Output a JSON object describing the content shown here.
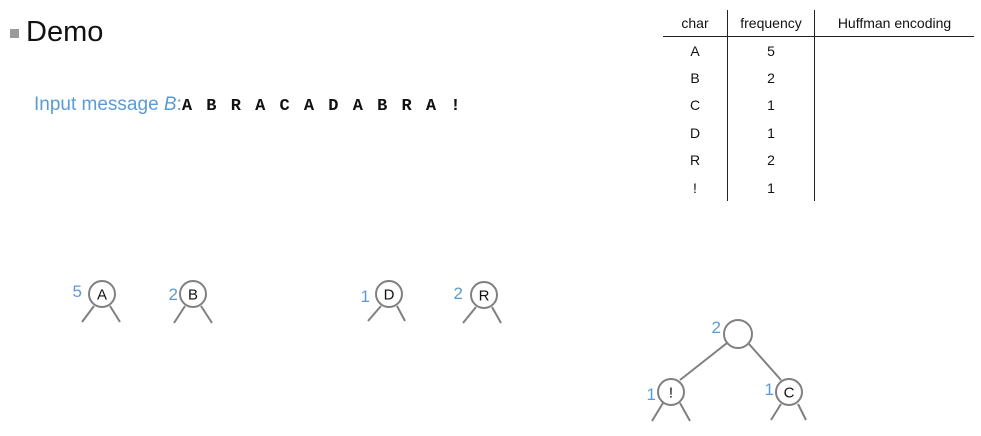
{
  "slide": {
    "title": "Demo",
    "input_label": "Input message ",
    "input_var": "B",
    "input_sep": ":",
    "input_message": "A B R A C A D A B R A !"
  },
  "table": {
    "headers": [
      "char",
      "frequency",
      "Huffman encoding"
    ],
    "rows": [
      {
        "char": "A",
        "frequency": "5",
        "encoding": ""
      },
      {
        "char": "B",
        "frequency": "2",
        "encoding": ""
      },
      {
        "char": "C",
        "frequency": "1",
        "encoding": ""
      },
      {
        "char": "D",
        "frequency": "1",
        "encoding": ""
      },
      {
        "char": "R",
        "frequency": "2",
        "encoding": ""
      },
      {
        "char": "!",
        "frequency": "1",
        "encoding": ""
      }
    ]
  },
  "nodes": [
    {
      "id": "A",
      "label": "A",
      "weight": "5"
    },
    {
      "id": "B",
      "label": "B",
      "weight": "2"
    },
    {
      "id": "D",
      "label": "D",
      "weight": "1"
    },
    {
      "id": "R",
      "label": "R",
      "weight": "2"
    },
    {
      "id": "P",
      "label": "",
      "weight": "2"
    },
    {
      "id": "X",
      "label": "!",
      "weight": "1"
    },
    {
      "id": "C",
      "label": "C",
      "weight": "1"
    }
  ],
  "colors": {
    "weight": "#5b9bd5",
    "edge": "#808080"
  }
}
